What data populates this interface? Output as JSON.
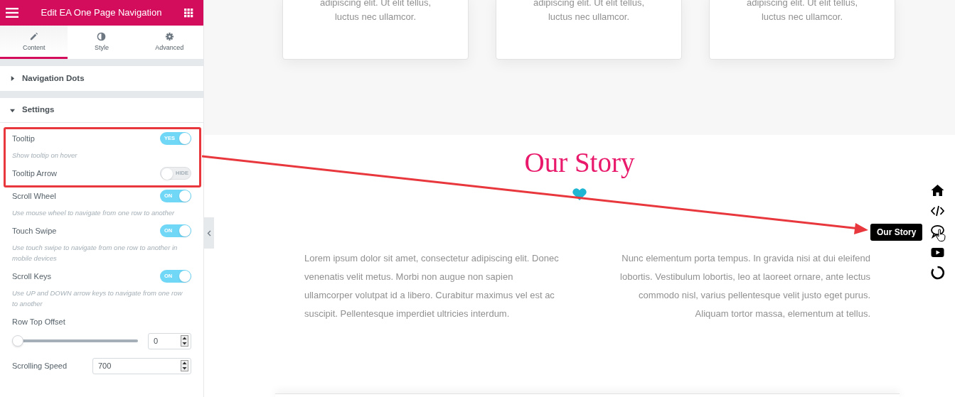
{
  "panel": {
    "title": "Edit EA One Page Navigation",
    "tabs": [
      {
        "label": "Content",
        "selected": true
      },
      {
        "label": "Style",
        "selected": false
      },
      {
        "label": "Advanced",
        "selected": false
      }
    ],
    "sections": [
      {
        "title": "Navigation Dots",
        "expanded": false
      },
      {
        "title": "Settings",
        "expanded": true
      }
    ],
    "controls": [
      {
        "kind": "toggle",
        "label": "Tooltip",
        "on": true,
        "switch_text": "YES",
        "description": "Show tooltip on hover",
        "highlighted": true
      },
      {
        "kind": "toggle",
        "label": "Tooltip Arrow",
        "on": false,
        "switch_text": "HIDE",
        "highlighted": true
      },
      {
        "kind": "toggle",
        "label": "Scroll Wheel",
        "on": true,
        "switch_text": "ON",
        "description": "Use mouse wheel to navigate from one row to another"
      },
      {
        "kind": "toggle",
        "label": "Touch Swipe",
        "on": true,
        "switch_text": "ON",
        "description": "Use touch swipe to navigate from one row to another in mobile devices"
      },
      {
        "kind": "toggle",
        "label": "Scroll Keys",
        "on": true,
        "switch_text": "ON",
        "description": "Use UP and DOWN arrow keys to navigate from one row to another"
      },
      {
        "kind": "slider",
        "label": "Row Top Offset",
        "level": 0,
        "value": "0"
      },
      {
        "kind": "number",
        "label": "Scrolling Speed",
        "value": "700"
      }
    ]
  },
  "cards": [
    {
      "lines": [
        "adipiscing elit. Ut elit tellus,",
        "luctus nec ullamcor."
      ]
    },
    {
      "lines": [
        "adipiscing elit. Ut elit tellus,",
        "luctus nec ullamcor."
      ]
    },
    {
      "lines": [
        "adipiscing elit. Ut elit tellus,",
        "luctus nec ullamcor."
      ]
    }
  ],
  "story": {
    "title": "Our Story",
    "paragraphs": [
      {
        "lines": [
          "Lorem ipsum dolor sit amet, consectetur adipiscing elit. Donec",
          "venenatis velit metus. Morbi non augue non sapien",
          "ullamcorper volutpat id a libero. Curabitur maximus vel est ac",
          "suscipit. Pellentesque imperdiet ultricies interdum."
        ]
      },
      {
        "lines": [
          "Nunc elementum porta tempus. In gravida nisi at dui eleifend",
          "lobortis. Vestibulum lobortis, leo at laoreet ornare, ante lectus",
          "commodo nisl, varius pellentesque velit justo eget purus.",
          "Aliquam tortor massa, elementum at tellus."
        ]
      }
    ]
  },
  "nav": {
    "items": [
      {
        "hovered": false
      },
      {
        "hovered": false
      },
      {
        "hovered": true
      },
      {
        "hovered": false
      },
      {
        "hovered": false
      }
    ],
    "tooltip": "Our Story"
  }
}
